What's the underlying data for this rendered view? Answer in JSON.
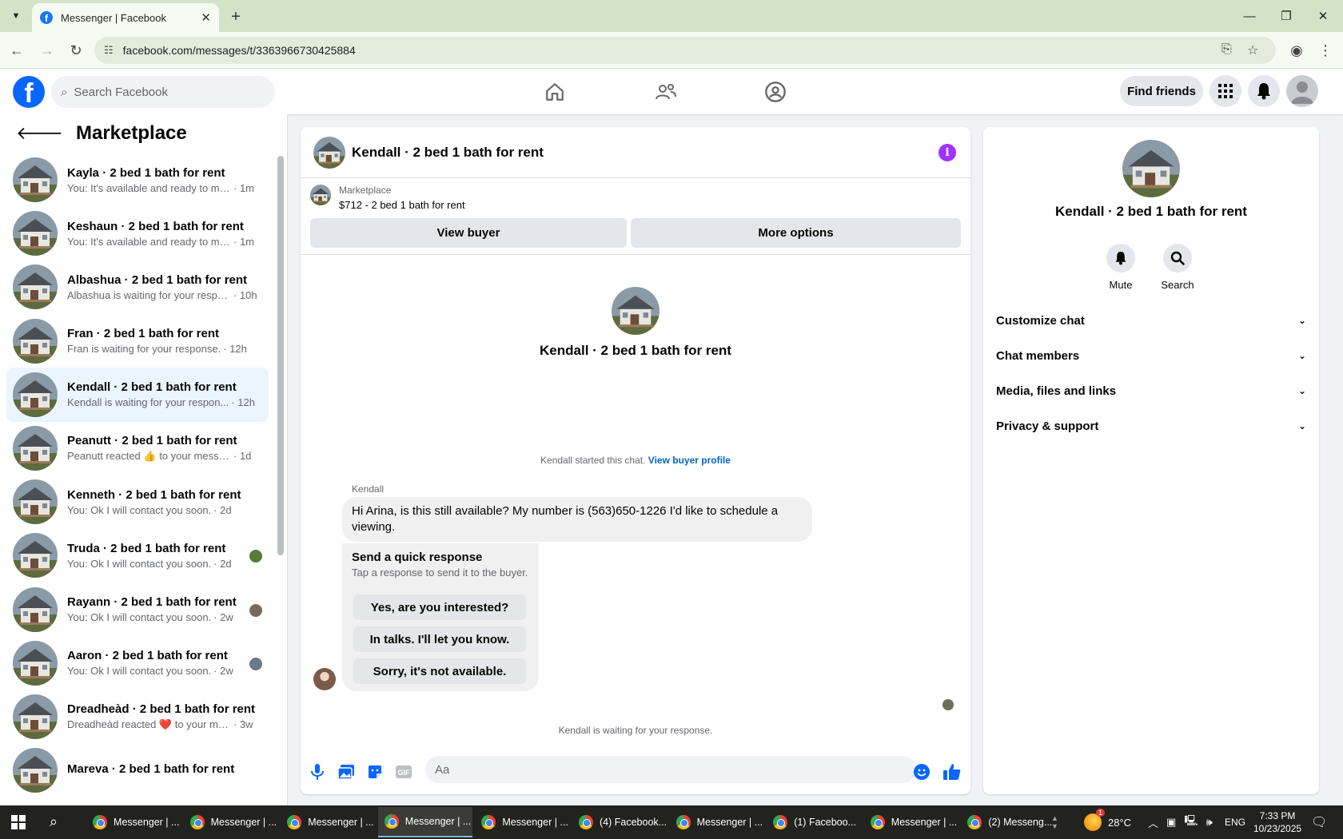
{
  "browser": {
    "tab_title": "Messenger | Facebook",
    "url": "facebook.com/messages/t/3363966730425884"
  },
  "fb": {
    "search_placeholder": "Search Facebook",
    "find_friends": "Find friends"
  },
  "sidebar": {
    "title": "Marketplace",
    "conversations": [
      {
        "name": "Kayla · 2 bed 1 bath for rent",
        "preview": "You: It's available and ready to mo...",
        "time": "· 1m"
      },
      {
        "name": "Keshaun · 2 bed 1 bath for rent",
        "preview": "You: It's available and ready to mo...",
        "time": "· 1m"
      },
      {
        "name": "Albashua · 2 bed 1 bath for rent",
        "preview": "Albashua is waiting for your respo...",
        "time": "· 10h"
      },
      {
        "name": "Fran · 2 bed 1 bath for rent",
        "preview": "Fran is waiting for your response.",
        "time": "· 12h"
      },
      {
        "name": "Kendall · 2 bed 1 bath for rent",
        "preview": "Kendall is waiting for your respon...",
        "time": "· 12h"
      },
      {
        "name": "Peanutt · 2 bed 1 bath for rent",
        "preview": "Peanutt reacted 👍 to your message",
        "time": "· 1d"
      },
      {
        "name": "Kenneth · 2 bed 1 bath for rent",
        "preview": "You: Ok I will contact you soon.",
        "time": "· 2d"
      },
      {
        "name": "Truda · 2 bed 1 bath for rent",
        "preview": "You: Ok I will contact you soon.",
        "time": "· 2d"
      },
      {
        "name": "Rayann · 2 bed 1 bath for rent",
        "preview": "You: Ok I will contact you soon.",
        "time": "· 2w"
      },
      {
        "name": "Aaron · 2 bed 1 bath for rent",
        "preview": "You: Ok I will contact you soon.",
        "time": "· 2w"
      },
      {
        "name": "Dreadheàd · 2 bed 1 bath for rent",
        "preview": "Dreadheàd reacted ❤️ to your me...",
        "time": "· 3w"
      },
      {
        "name": "Mareva · 2 bed 1 bath for rent",
        "preview": "",
        "time": ""
      }
    ]
  },
  "chat": {
    "header_title": "Kendall · 2 bed 1 bath for rent",
    "listing_source": "Marketplace",
    "listing_title": "$712 - 2 bed 1 bath for rent",
    "view_buyer": "View buyer",
    "more_options": "More options",
    "center_name": "Kendall · 2 bed 1 bath for rent",
    "started_text": "Kendall started this chat.",
    "view_buyer_profile": "View buyer profile",
    "sender": "Kendall",
    "message": "Hi Arina, is this still available? My number is (563)650-1226 I'd like to schedule a viewing.",
    "quick_title": "Send a quick response",
    "quick_subtitle": "Tap a response to send it to the buyer.",
    "quick_replies": [
      "Yes, are you interested?",
      "In talks. I'll let you know.",
      "Sorry, it's not available."
    ],
    "waiting": "Kendall is waiting for your response.",
    "composer_placeholder": "Aa"
  },
  "right_panel": {
    "name": "Kendall · 2 bed 1 bath for rent",
    "mute": "Mute",
    "search": "Search",
    "sections": [
      "Customize chat",
      "Chat members",
      "Media, files and links",
      "Privacy & support"
    ]
  },
  "taskbar": {
    "items": [
      "Messenger | ...",
      "Messenger | ...",
      "Messenger | ...",
      "Messenger | ...",
      "Messenger | ...",
      "(4) Facebook...",
      "Messenger | ...",
      "(1) Faceboo...",
      "Messenger | ...",
      "(2) Messeng..."
    ],
    "weather_badge": "1",
    "temperature": "28°C",
    "language": "ENG",
    "time": "7:33 PM",
    "date": "10/23/2025"
  },
  "colors": {
    "fb_blue": "#0866ff",
    "active_conv": "#ebf5ff",
    "info_purple": "#a033ff",
    "link": "#0064d1"
  }
}
